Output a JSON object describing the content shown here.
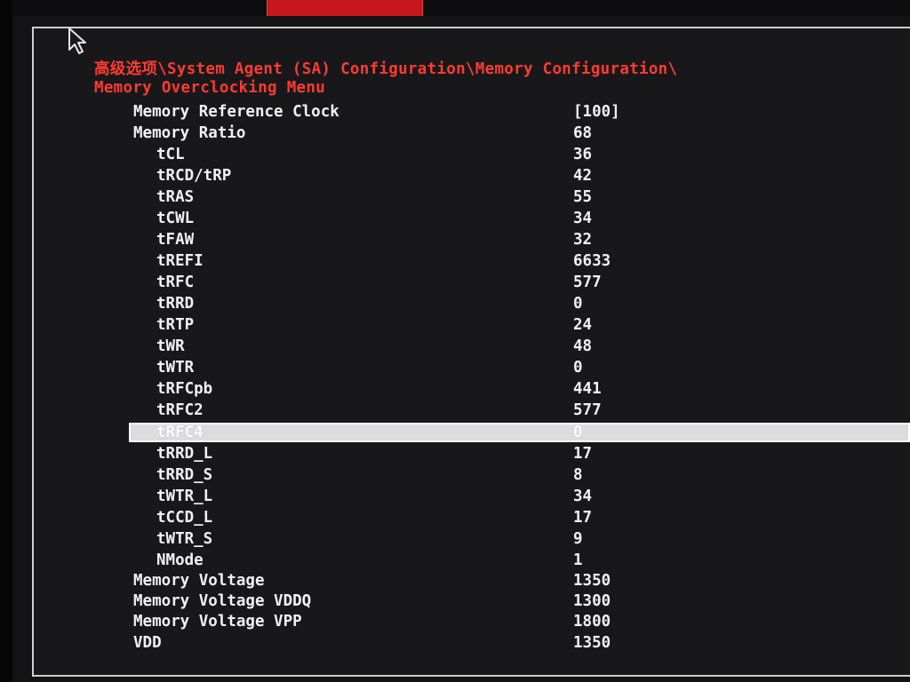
{
  "menu": {
    "tabs": [
      {
        "label": "",
        "active": false
      },
      {
        "label": "",
        "active": true
      },
      {
        "label": "",
        "active": false
      },
      {
        "label": "",
        "active": false
      },
      {
        "label": "",
        "active": false
      }
    ]
  },
  "breadcrumb": {
    "line1": "高级选项\\System Agent (SA) Configuration\\Memory Configuration\\",
    "line2": "Memory Overclocking Menu"
  },
  "settings": [
    {
      "label": "Memory Reference Clock",
      "value": "[100]",
      "indent": false
    },
    {
      "label": "Memory Ratio",
      "value": "68",
      "indent": false
    },
    {
      "label": "tCL",
      "value": "36",
      "indent": true
    },
    {
      "label": "tRCD/tRP",
      "value": "42",
      "indent": true
    },
    {
      "label": "tRAS",
      "value": "55",
      "indent": true
    },
    {
      "label": "tCWL",
      "value": "34",
      "indent": true
    },
    {
      "label": "tFAW",
      "value": "32",
      "indent": true
    },
    {
      "label": "tREFI",
      "value": "6633",
      "indent": true
    },
    {
      "label": "tRFC",
      "value": "577",
      "indent": true
    },
    {
      "label": "tRRD",
      "value": "0",
      "indent": true
    },
    {
      "label": "tRTP",
      "value": "24",
      "indent": true
    },
    {
      "label": "tWR",
      "value": "48",
      "indent": true
    },
    {
      "label": "tWTR",
      "value": "0",
      "indent": true
    },
    {
      "label": "tRFCpb",
      "value": "441",
      "indent": true
    },
    {
      "label": "tRFC2",
      "value": "577",
      "indent": true
    },
    {
      "label": "tRFC4",
      "value": "0",
      "indent": true,
      "selected": true
    },
    {
      "label": "tRRD_L",
      "value": "17",
      "indent": true
    },
    {
      "label": "tRRD_S",
      "value": "8",
      "indent": true
    },
    {
      "label": "tWTR_L",
      "value": "34",
      "indent": true
    },
    {
      "label": "tCCD_L",
      "value": "17",
      "indent": true
    },
    {
      "label": "tWTR_S",
      "value": "9",
      "indent": true
    },
    {
      "label": "NMode",
      "value": "1",
      "indent": true
    },
    {
      "label": "Memory Voltage",
      "value": "1350",
      "indent": false
    },
    {
      "label": "Memory Voltage VDDQ",
      "value": "1300",
      "indent": false
    },
    {
      "label": "Memory Voltage VPP",
      "value": "1800",
      "indent": false
    },
    {
      "label": "VDD",
      "value": "1350",
      "indent": false
    }
  ],
  "colors": {
    "accent": "#c8161d",
    "breadcrumb": "#ff3b2f",
    "text": "#f1f1f3",
    "selection": "#dcdcdc"
  },
  "icons": {
    "cursor": "mouse-pointer-icon"
  }
}
